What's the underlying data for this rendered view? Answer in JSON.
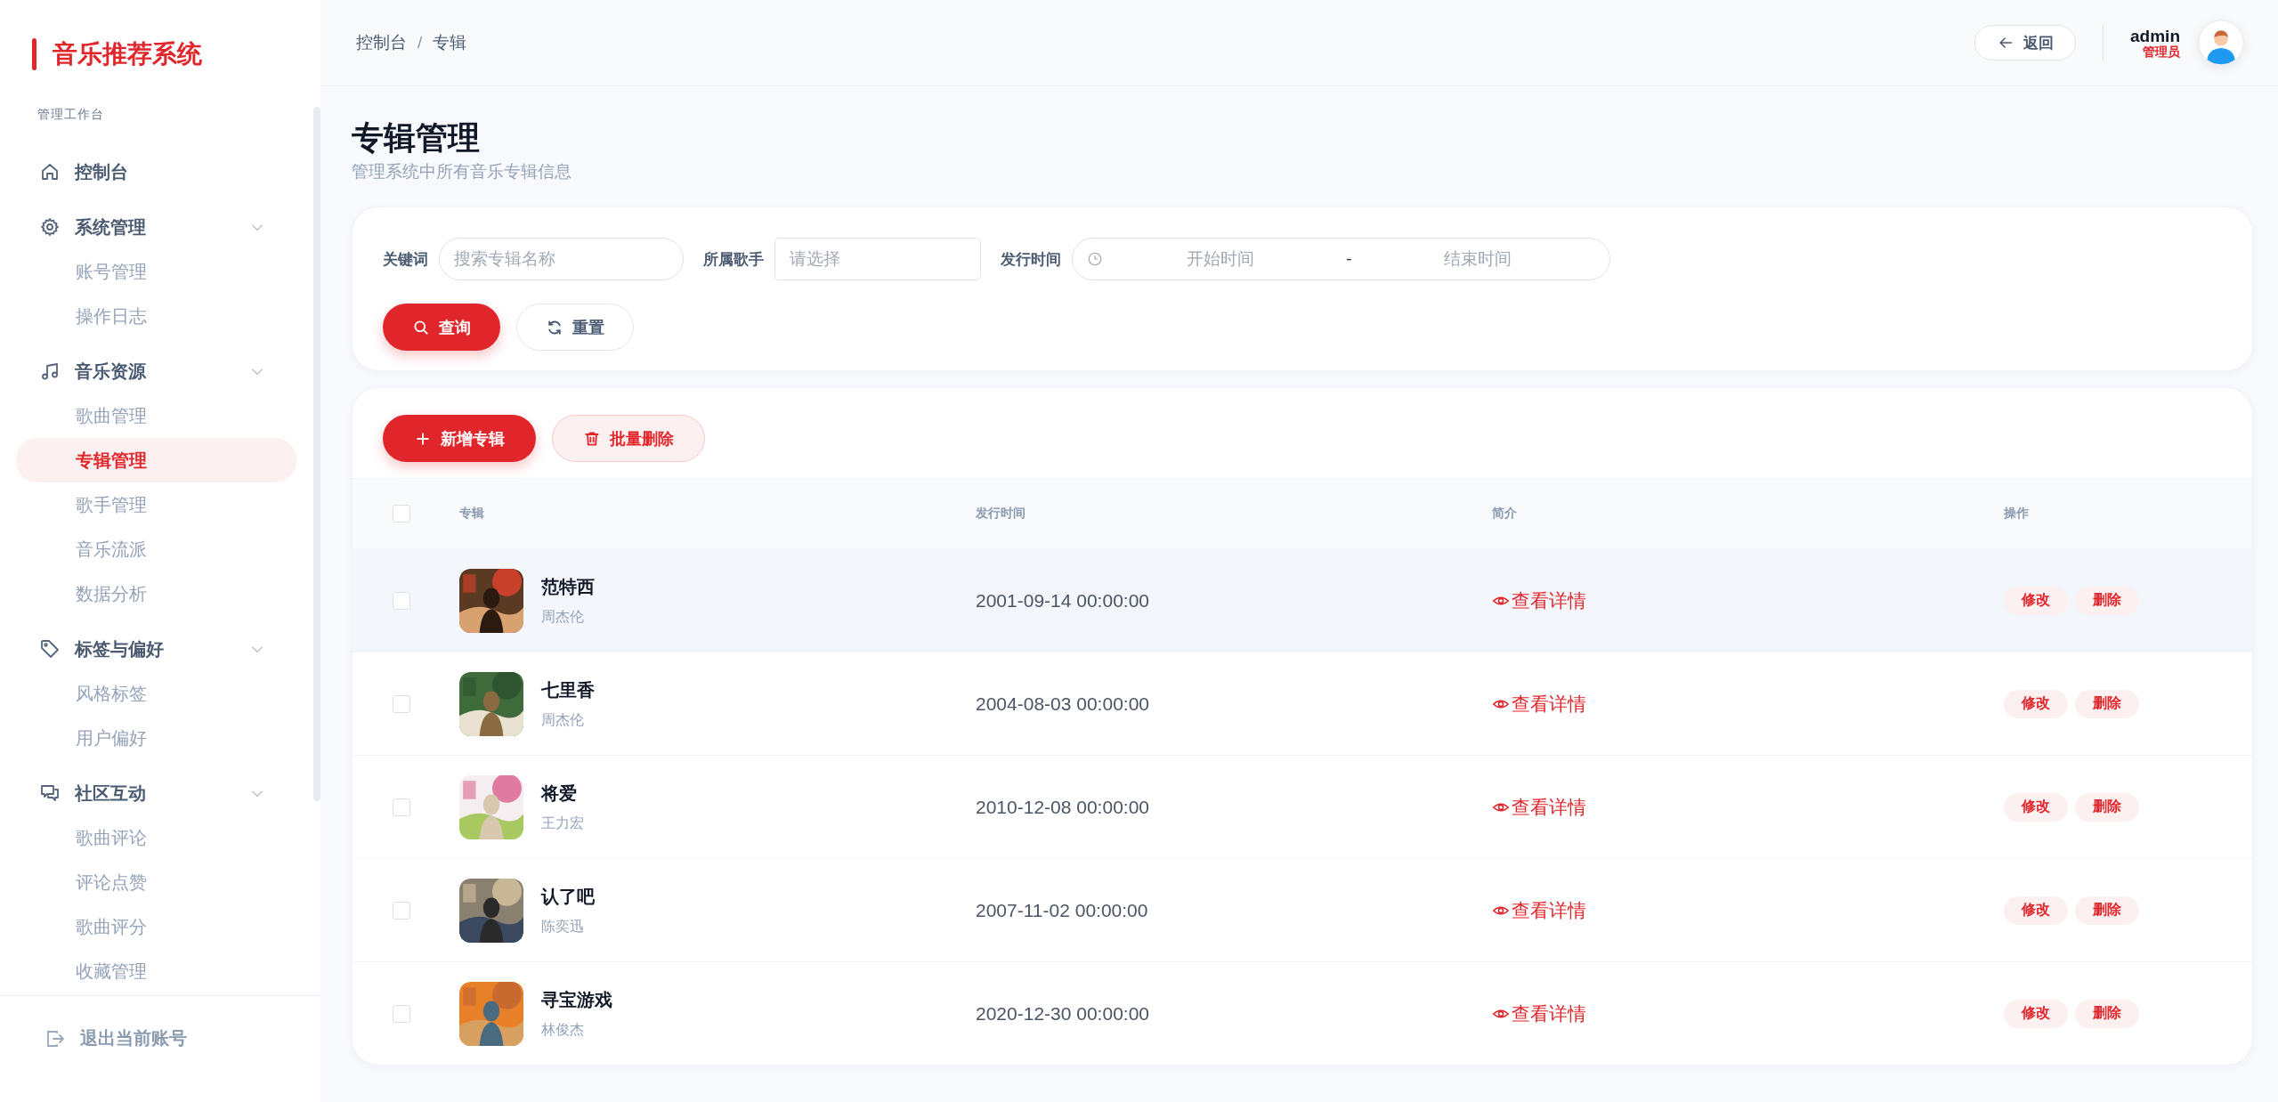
{
  "sidebar": {
    "title": "音乐推荐系统",
    "section_label": "管理工作台",
    "items": [
      {
        "label": "控制台",
        "selected": false
      },
      {
        "label": "系统管理",
        "selected": false,
        "expanded": true,
        "children": [
          {
            "label": "账号管理",
            "selected": false
          },
          {
            "label": "操作日志",
            "selected": false
          }
        ]
      },
      {
        "label": "音乐资源",
        "selected": false,
        "expanded": true,
        "children": [
          {
            "label": "歌曲管理",
            "selected": false
          },
          {
            "label": "专辑管理",
            "selected": true
          },
          {
            "label": "歌手管理",
            "selected": false
          },
          {
            "label": "音乐流派",
            "selected": false
          },
          {
            "label": "数据分析",
            "selected": false
          }
        ]
      },
      {
        "label": "标签与偏好",
        "selected": false,
        "expanded": true,
        "children": [
          {
            "label": "风格标签",
            "selected": false
          },
          {
            "label": "用户偏好",
            "selected": false
          }
        ]
      },
      {
        "label": "社区互动",
        "selected": false,
        "expanded": true,
        "children": [
          {
            "label": "歌曲评论",
            "selected": false
          },
          {
            "label": "评论点赞",
            "selected": false
          },
          {
            "label": "歌曲评分",
            "selected": false
          },
          {
            "label": "收藏管理",
            "selected": false
          }
        ]
      }
    ],
    "logout": "退出当前账号"
  },
  "header": {
    "breadcrumb": {
      "items": [
        "控制台",
        "专辑"
      ],
      "separator": "/"
    },
    "back_button": "返回",
    "user": {
      "name": "admin",
      "role": "管理员"
    }
  },
  "page": {
    "title": "专辑管理",
    "subtitle": "管理系统中所有音乐专辑信息"
  },
  "filters": {
    "keyword": {
      "label": "关键词",
      "placeholder": "搜索专辑名称"
    },
    "singer": {
      "label": "所属歌手",
      "placeholder": "请选择"
    },
    "release": {
      "label": "发行时间",
      "start_placeholder": "开始时间",
      "separator": "-",
      "end_placeholder": "结束时间"
    },
    "search_button": "查询",
    "reset_button": "重置"
  },
  "toolbar": {
    "add_button": "新增专辑",
    "batch_delete_button": "批量删除"
  },
  "table": {
    "select_all_checked": false,
    "columns": [
      "专辑",
      "发行时间",
      "简介",
      "操作"
    ],
    "rows": [
      {
        "checked": false,
        "hover": true,
        "name": "范特西",
        "singer": "周杰伦",
        "release": "2001-09-14 00:00:00",
        "detail": "查看详情",
        "edit": "修改",
        "delete": "删除"
      },
      {
        "checked": false,
        "hover": false,
        "name": "七里香",
        "singer": "周杰伦",
        "release": "2004-08-03 00:00:00",
        "detail": "查看详情",
        "edit": "修改",
        "delete": "删除"
      },
      {
        "checked": false,
        "hover": false,
        "name": "将爱",
        "singer": "王力宏",
        "release": "2010-12-08 00:00:00",
        "detail": "查看详情",
        "edit": "修改",
        "delete": "删除"
      },
      {
        "checked": false,
        "hover": false,
        "name": "认了吧",
        "singer": "陈奕迅",
        "release": "2007-11-02 00:00:00",
        "detail": "查看详情",
        "edit": "修改",
        "delete": "删除"
      },
      {
        "checked": false,
        "hover": false,
        "name": "寻宝游戏",
        "singer": "林俊杰",
        "release": "2020-12-30 00:00:00",
        "detail": "查看详情",
        "edit": "修改",
        "delete": "删除"
      }
    ]
  }
}
